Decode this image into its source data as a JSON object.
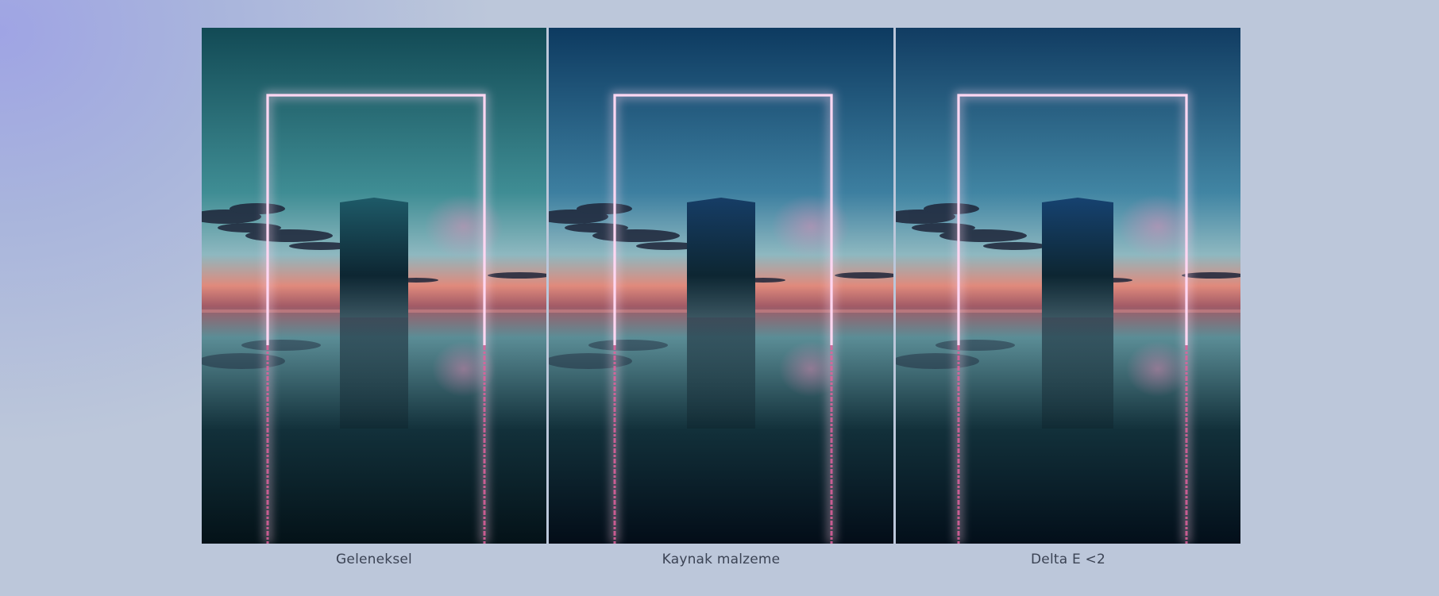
{
  "comparison": {
    "panels": [
      {
        "caption": "Geleneksel",
        "colors": {
          "sky_top": "#124a55",
          "sky_mid": "#3f8d94",
          "water_bottom": "#041218",
          "monolith": "#1e5a68"
        }
      },
      {
        "caption": "Kaynak malzeme",
        "colors": {
          "sky_top": "#0d3a60",
          "sky_mid": "#3d7fa0",
          "water_bottom": "#030d18",
          "monolith": "#163d66"
        }
      },
      {
        "caption": "Delta E <2",
        "colors": {
          "sky_top": "#113c62",
          "sky_mid": "#4185a3",
          "water_bottom": "#030f1a",
          "monolith": "#164270"
        }
      }
    ],
    "accent_neon": "#ffd7f2"
  }
}
